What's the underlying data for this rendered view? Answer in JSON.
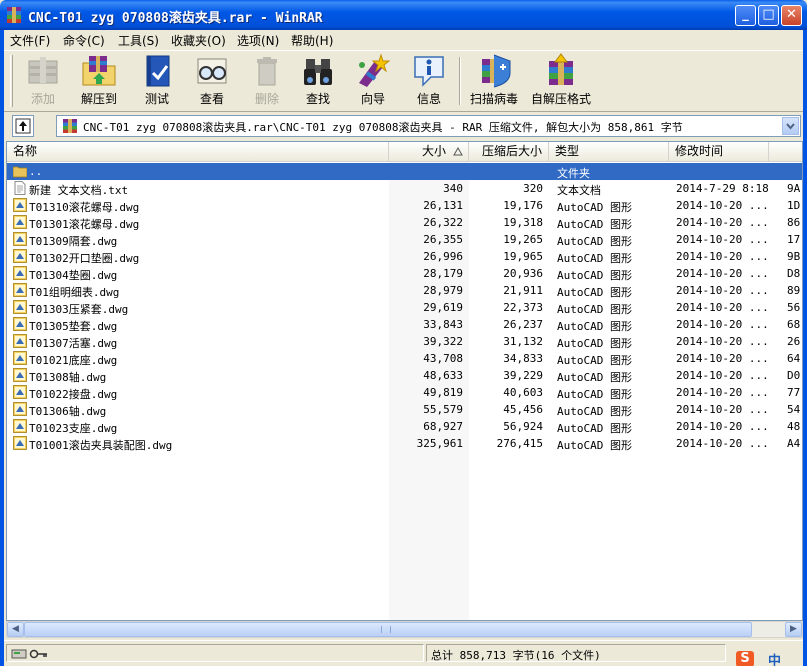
{
  "window": {
    "title": "CNC-T01   zyg 070808滚齿夹具.rar - WinRAR",
    "min_glyph": "_",
    "max_glyph": "□",
    "close_glyph": "✕"
  },
  "menu": [
    "文件(F)",
    "命令(C)",
    "工具(S)",
    "收藏夹(O)",
    "选项(N)",
    "帮助(H)"
  ],
  "toolbar": {
    "add": "添加",
    "extract": "解压到",
    "test": "测试",
    "view": "查看",
    "delete": "删除",
    "find": "查找",
    "wizard": "向导",
    "info": "信息",
    "virus_scan": "扫描病毒",
    "sfx": "自解压格式"
  },
  "address": {
    "text": "CNC-T01   zyg 070808滚齿夹具.rar\\CNC-T01   zyg 070808滚齿夹具 - RAR 压缩文件, 解包大小为 858,861 字节"
  },
  "columns": {
    "name": "名称",
    "size": "大小",
    "packed": "压缩后大小",
    "type": "类型",
    "modified": "修改时间"
  },
  "rows": [
    {
      "name": "..",
      "size": "",
      "packed": "",
      "type": "文件夹",
      "modified": "",
      "extra": "",
      "icon": "folder-up-icon",
      "selected": true
    },
    {
      "name": "新建 文本文档.txt",
      "size": "340",
      "packed": "320",
      "type": "文本文档",
      "modified": "2014-7-29 8:18",
      "extra": "9A",
      "icon": "text-file-icon"
    },
    {
      "name": "T01310滚花螺母.dwg",
      "size": "26,131",
      "packed": "19,176",
      "type": "AutoCAD 图形",
      "modified": "2014-10-20 ...",
      "extra": "1D",
      "icon": "dwg-file-icon"
    },
    {
      "name": "T01301滚花螺母.dwg",
      "size": "26,322",
      "packed": "19,318",
      "type": "AutoCAD 图形",
      "modified": "2014-10-20 ...",
      "extra": "86",
      "icon": "dwg-file-icon"
    },
    {
      "name": "T01309隔套.dwg",
      "size": "26,355",
      "packed": "19,265",
      "type": "AutoCAD 图形",
      "modified": "2014-10-20 ...",
      "extra": "17",
      "icon": "dwg-file-icon"
    },
    {
      "name": "T01302开口垫圈.dwg",
      "size": "26,996",
      "packed": "19,965",
      "type": "AutoCAD 图形",
      "modified": "2014-10-20 ...",
      "extra": "9B",
      "icon": "dwg-file-icon"
    },
    {
      "name": "T01304垫圈.dwg",
      "size": "28,179",
      "packed": "20,936",
      "type": "AutoCAD 图形",
      "modified": "2014-10-20 ...",
      "extra": "D8",
      "icon": "dwg-file-icon"
    },
    {
      "name": "T01组明细表.dwg",
      "size": "28,979",
      "packed": "21,911",
      "type": "AutoCAD 图形",
      "modified": "2014-10-20 ...",
      "extra": "89",
      "icon": "dwg-file-icon"
    },
    {
      "name": "T01303压紧套.dwg",
      "size": "29,619",
      "packed": "22,373",
      "type": "AutoCAD 图形",
      "modified": "2014-10-20 ...",
      "extra": "56",
      "icon": "dwg-file-icon"
    },
    {
      "name": "T01305垫套.dwg",
      "size": "33,843",
      "packed": "26,237",
      "type": "AutoCAD 图形",
      "modified": "2014-10-20 ...",
      "extra": "68",
      "icon": "dwg-file-icon"
    },
    {
      "name": "T01307活塞.dwg",
      "size": "39,322",
      "packed": "31,132",
      "type": "AutoCAD 图形",
      "modified": "2014-10-20 ...",
      "extra": "26",
      "icon": "dwg-file-icon"
    },
    {
      "name": "T01021底座.dwg",
      "size": "43,708",
      "packed": "34,833",
      "type": "AutoCAD 图形",
      "modified": "2014-10-20 ...",
      "extra": "64",
      "icon": "dwg-file-icon"
    },
    {
      "name": "T01308轴.dwg",
      "size": "48,633",
      "packed": "39,229",
      "type": "AutoCAD 图形",
      "modified": "2014-10-20 ...",
      "extra": "D0",
      "icon": "dwg-file-icon"
    },
    {
      "name": "T01022接盘.dwg",
      "size": "49,819",
      "packed": "40,603",
      "type": "AutoCAD 图形",
      "modified": "2014-10-20 ...",
      "extra": "77",
      "icon": "dwg-file-icon"
    },
    {
      "name": "T01306轴.dwg",
      "size": "55,579",
      "packed": "45,456",
      "type": "AutoCAD 图形",
      "modified": "2014-10-20 ...",
      "extra": "54",
      "icon": "dwg-file-icon"
    },
    {
      "name": "T01023支座.dwg",
      "size": "68,927",
      "packed": "56,924",
      "type": "AutoCAD 图形",
      "modified": "2014-10-20 ...",
      "extra": "48",
      "icon": "dwg-file-icon"
    },
    {
      "name": "T01001滚齿夹具装配图.dwg",
      "size": "325,961",
      "packed": "276,415",
      "type": "AutoCAD 图形",
      "modified": "2014-10-20 ...",
      "extra": "A4",
      "icon": "dwg-file-icon"
    }
  ],
  "status": {
    "total": "总计 858,713 字节(16 个文件)"
  },
  "ime": {
    "logo": "S",
    "lang": "中"
  },
  "colors": {
    "titlebar": "#0054E3",
    "selection": "#316AC5",
    "face": "#ECE9D8"
  }
}
